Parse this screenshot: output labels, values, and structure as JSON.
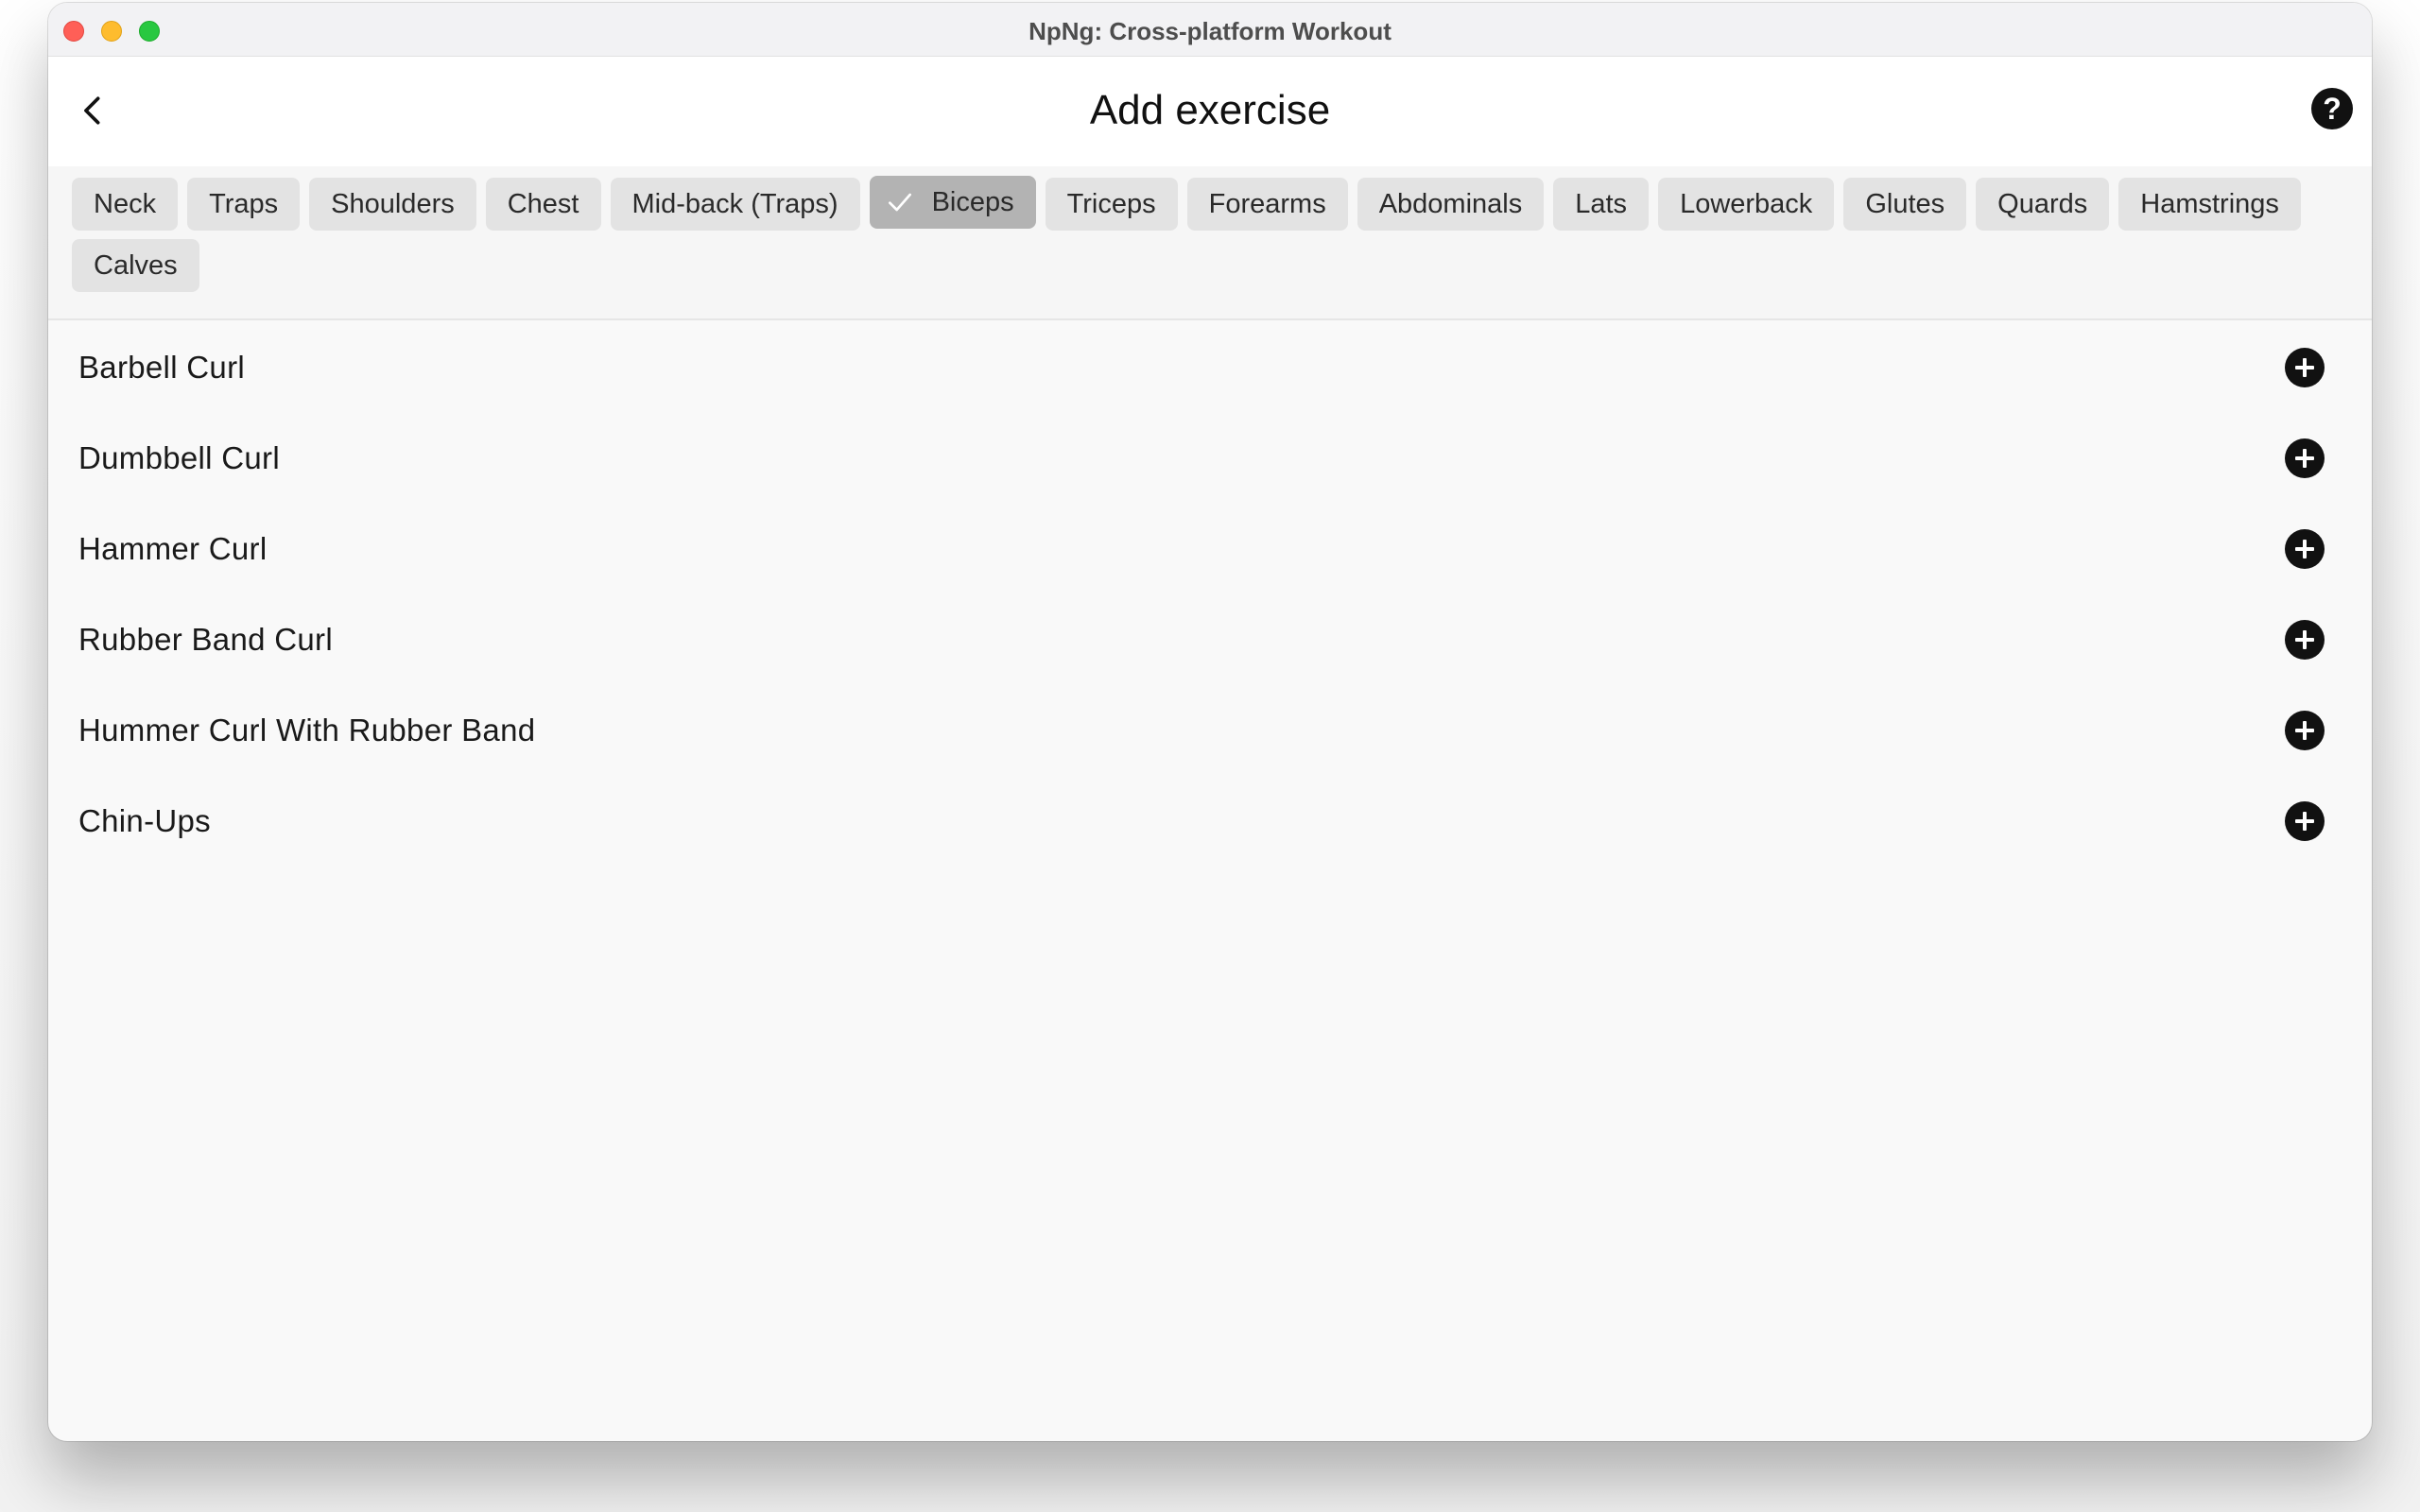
{
  "window": {
    "title": "NpNg: Cross-platform Workout"
  },
  "header": {
    "title": "Add exercise",
    "back_icon": "chevron-left-icon",
    "help_icon": "question-mark-icon",
    "help_label": "?"
  },
  "filters": [
    {
      "label": "Neck",
      "selected": false
    },
    {
      "label": "Traps",
      "selected": false
    },
    {
      "label": "Shoulders",
      "selected": false
    },
    {
      "label": "Chest",
      "selected": false
    },
    {
      "label": "Mid-back (Traps)",
      "selected": false
    },
    {
      "label": "Biceps",
      "selected": true
    },
    {
      "label": "Triceps",
      "selected": false
    },
    {
      "label": "Forearms",
      "selected": false
    },
    {
      "label": "Abdominals",
      "selected": false
    },
    {
      "label": "Lats",
      "selected": false
    },
    {
      "label": "Lowerback",
      "selected": false
    },
    {
      "label": "Glutes",
      "selected": false
    },
    {
      "label": "Quards",
      "selected": false
    },
    {
      "label": "Hamstrings",
      "selected": false
    },
    {
      "label": "Calves",
      "selected": false
    }
  ],
  "exercises": [
    {
      "name": "Barbell Curl"
    },
    {
      "name": "Dumbbell Curl"
    },
    {
      "name": "Hammer Curl"
    },
    {
      "name": "Rubber Band Curl"
    },
    {
      "name": "Hummer Curl With Rubber Band"
    },
    {
      "name": "Chin-Ups"
    }
  ],
  "colors": {
    "chip": "#e3e3e3",
    "chip_selected": "#b3b3b3",
    "icon": "#111111"
  }
}
